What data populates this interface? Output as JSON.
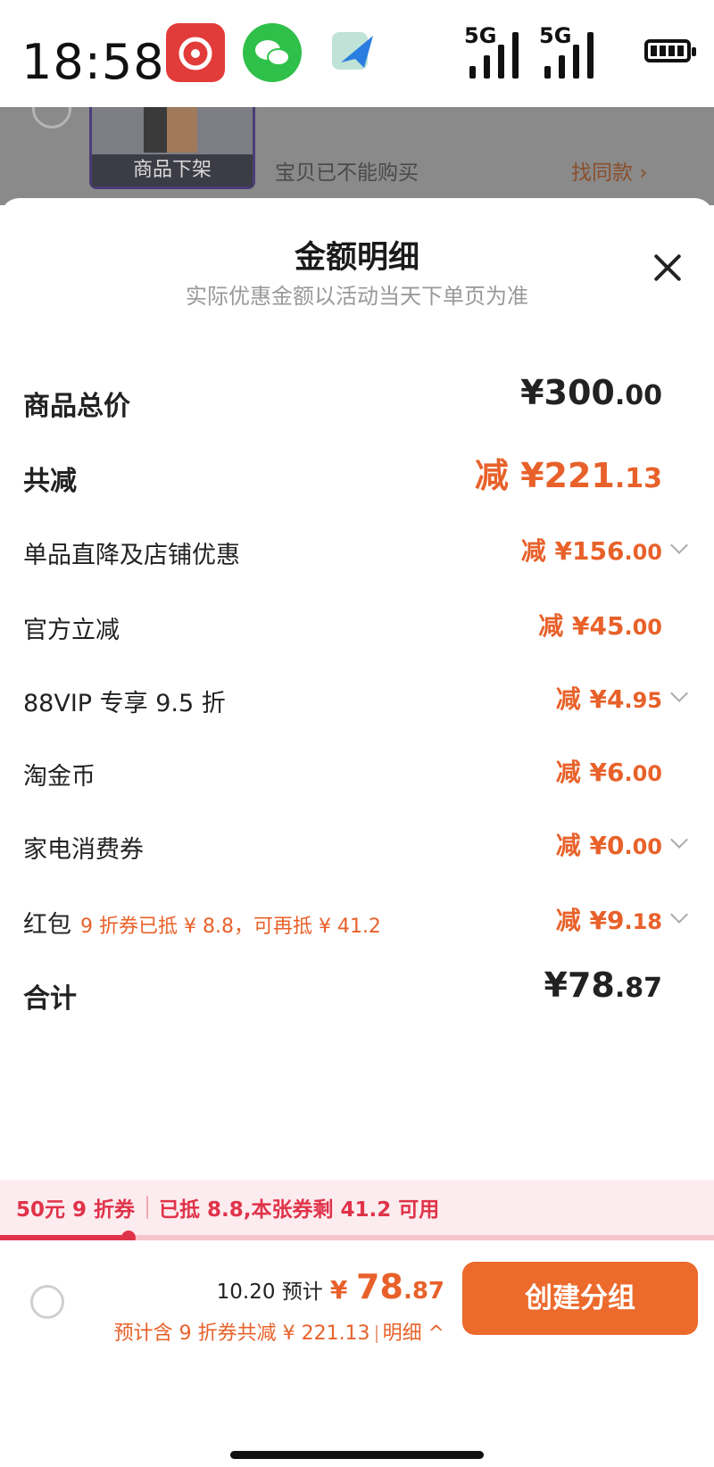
{
  "status_bar": {
    "time": "18:58",
    "signal_1": "5G",
    "signal_2": "5G",
    "apps": [
      "netease-music-icon",
      "wechat-icon",
      "mail-app-icon"
    ]
  },
  "background": {
    "thumb_label": "商品下架",
    "unavailable": "宝贝已不能购买",
    "find_similar": "找同款 ›"
  },
  "sheet": {
    "title": "金额明细",
    "subtitle": "实际优惠金额以活动当天下单页为准"
  },
  "rows": {
    "total_price": {
      "label": "商品总价",
      "main": "¥300",
      "cents": ".00"
    },
    "total_discount": {
      "label": "共减",
      "main": "减 ¥221",
      "cents": ".13"
    },
    "store_discount": {
      "label": "单品直降及店铺优惠",
      "main": "减 ¥156",
      "cents": ".00"
    },
    "official": {
      "label": "官方立减",
      "main": "减 ¥45",
      "cents": ".00"
    },
    "vip": {
      "label": "88VIP 专享 9.5 折",
      "main": "减 ¥4",
      "cents": ".95"
    },
    "gold_coin": {
      "label": "淘金币",
      "main": "减 ¥6",
      "cents": ".00"
    },
    "appliance_coupon": {
      "label": "家电消费券",
      "main": "减 ¥0",
      "cents": ".00"
    },
    "red_packet": {
      "label": "红包",
      "note": "9 折券已抵 ¥ 8.8，可再抵 ¥ 41.2",
      "main": "减 ¥9",
      "cents": ".18"
    },
    "sum": {
      "label": "合计",
      "main": "¥78",
      "cents": ".87"
    }
  },
  "coupon_bar": {
    "coupon_name": "50元 9 折券",
    "coupon_status": "已抵 8.8,本张券剩 41.2 可用",
    "progress": 0.18
  },
  "bottom": {
    "est_label": "10.20 预计",
    "est_currency": "¥",
    "est_main": "78",
    "est_cents": ".87",
    "detail_text": "预计含 9 折券共减 ¥ 221.13",
    "detail_link": "明细 ^",
    "create_button": "创建分组"
  },
  "colors": {
    "accent_orange": "#e8612a",
    "coupon_red": "#e0334a",
    "button_orange": "#ec6a2c"
  }
}
